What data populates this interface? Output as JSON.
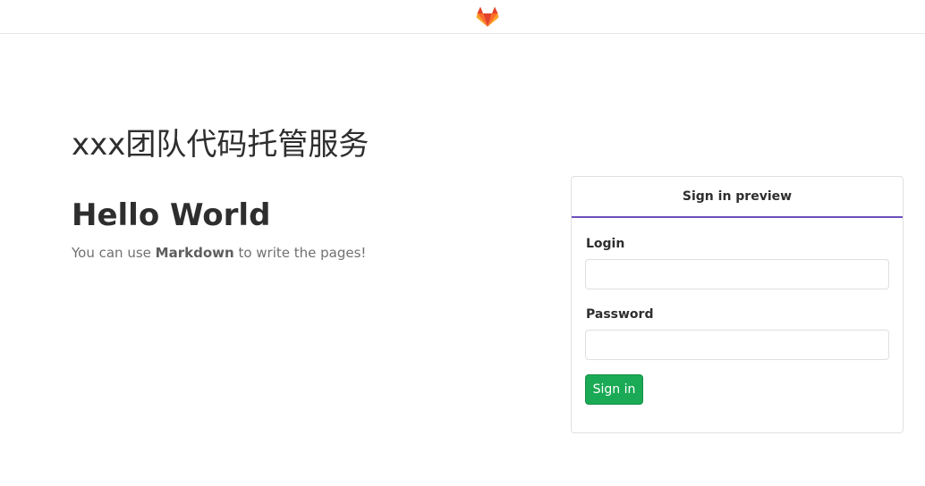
{
  "header": {
    "logo_icon": "gitlab-tanuki-icon"
  },
  "brand": {
    "title": "xxx团队代码托管服务"
  },
  "content": {
    "heading": "Hello World",
    "description_prefix": "You can use ",
    "description_bold": "Markdown",
    "description_suffix": " to write the pages!"
  },
  "signin_card": {
    "tab_label": "Sign in preview",
    "login_label": "Login",
    "login_value": "",
    "password_label": "Password",
    "password_value": "",
    "submit_label": "Sign in"
  },
  "colors": {
    "tab_underline": "#6b4fbb",
    "button_green": "#1aaa55",
    "logo_orange": "#fc6d26",
    "logo_red": "#e24329",
    "logo_light": "#fca326"
  }
}
